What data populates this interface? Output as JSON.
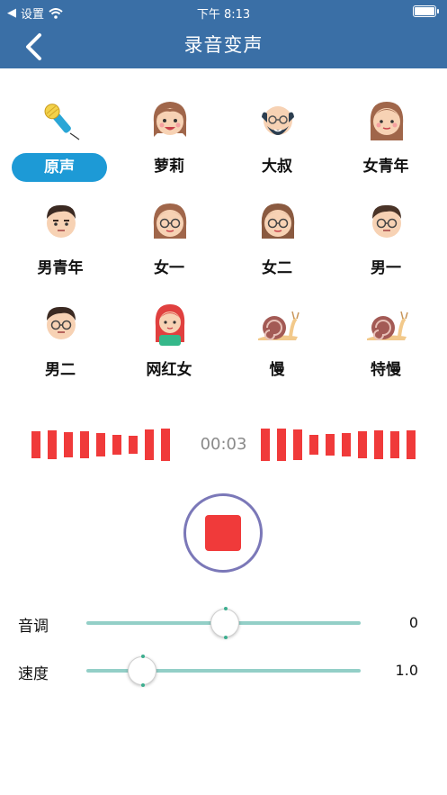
{
  "status_bar": {
    "carrier": "设置",
    "time": "下午 8:13"
  },
  "nav": {
    "title": "录音变声"
  },
  "voices": [
    {
      "label": "原声",
      "icon": "microphone-icon",
      "selected": true
    },
    {
      "label": "萝莉",
      "icon": "girl-face-icon"
    },
    {
      "label": "大叔",
      "icon": "uncle-face-icon"
    },
    {
      "label": "女青年",
      "icon": "young-woman-face-icon"
    },
    {
      "label": "男青年",
      "icon": "young-man-face-icon"
    },
    {
      "label": "女一",
      "icon": "woman-glasses-face-icon"
    },
    {
      "label": "女二",
      "icon": "woman-glasses-face-icon"
    },
    {
      "label": "男一",
      "icon": "man-glasses-face-icon"
    },
    {
      "label": "男二",
      "icon": "man-glasses-face-icon"
    },
    {
      "label": "网红女",
      "icon": "influencer-girl-icon"
    },
    {
      "label": "慢",
      "icon": "snail-icon"
    },
    {
      "label": "特慢",
      "icon": "snail-icon"
    }
  ],
  "recorder": {
    "elapsed": "00:03",
    "state": "recording"
  },
  "sliders": {
    "pitch": {
      "label": "音调",
      "value": "0",
      "position": 0.5
    },
    "speed": {
      "label": "速度",
      "value": "1.0",
      "position": 0.2
    }
  },
  "colors": {
    "header": "#3a6fa6",
    "accent": "#1d9ad6",
    "record": "#f03a3a",
    "slider_track": "#93cfc7"
  }
}
